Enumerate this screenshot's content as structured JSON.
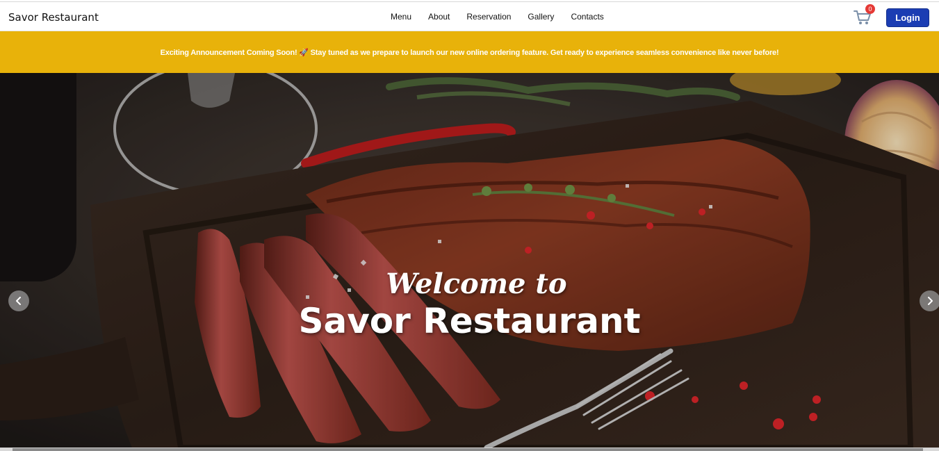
{
  "navbar": {
    "brand": "Savor Restaurant",
    "links": [
      "Menu",
      "About",
      "Reservation",
      "Gallery",
      "Contacts"
    ],
    "cart_count": "0",
    "cart_icon": "cart-icon",
    "login_label": "Login",
    "login_color": "#1b3db3"
  },
  "announcement": {
    "text": "Exciting Announcement Coming Soon! 🚀 Stay tuned as we prepare to launch our new online ordering feature. Get ready to experience seamless convenience like never before!",
    "background": "#e8b20a"
  },
  "hero": {
    "line1": "Welcome to",
    "line2": "Savor Restaurant",
    "prev_icon": "chevron-left-icon",
    "next_icon": "chevron-right-icon"
  }
}
